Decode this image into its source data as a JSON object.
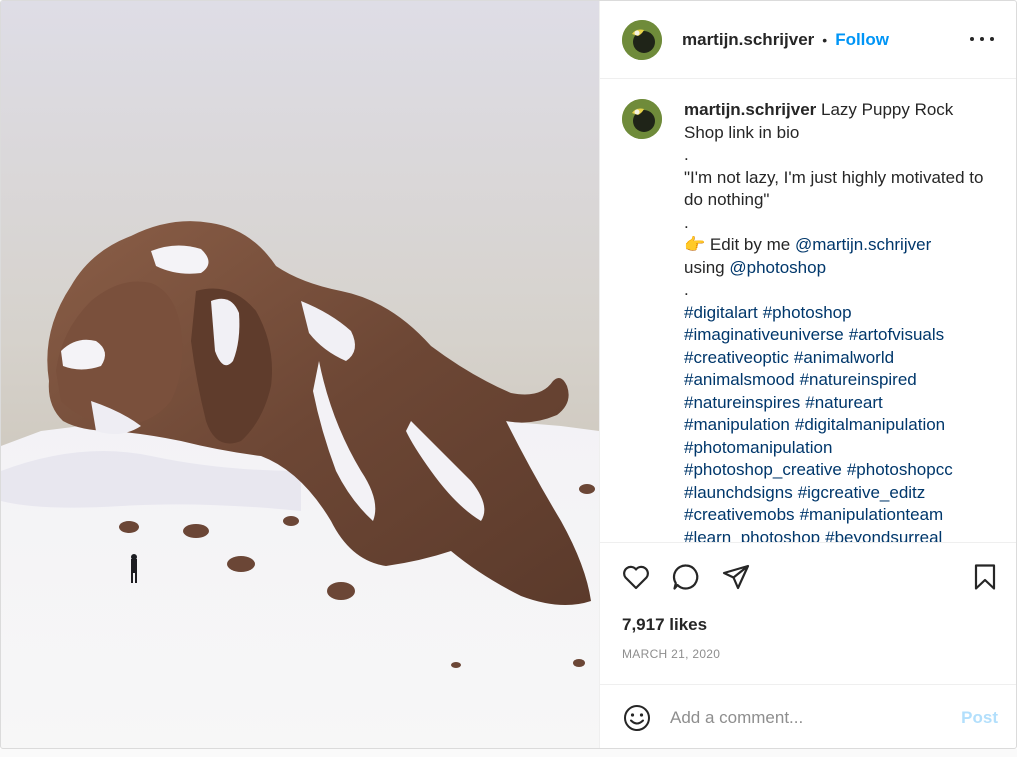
{
  "post": {
    "username": "martijn.schrijver",
    "separator": "•",
    "follow_label": "Follow"
  },
  "caption": {
    "username": "martijn.schrijver",
    "title": "Lazy Puppy Rock",
    "line_shop": "Shop link in bio",
    "dot1": ".",
    "quote": "\"I'm not lazy, I'm just highly motivated to do nothing\"",
    "dot2": ".",
    "edit_emoji": "👉",
    "edit_prefix": "Edit by me",
    "edit_mention": "@martijn.schrijver",
    "using_prefix": "using",
    "using_mention": "@photoshop",
    "dot3": ".",
    "hashtags": [
      "#digitalart",
      "#photoshop",
      "#imaginativeuniverse",
      "#artofvisuals",
      "#creativeoptic",
      "#animalworld",
      "#animalsmood",
      "#natureinspired",
      "#natureinspires",
      "#natureart",
      "#manipulation",
      "#digitalmanipulation",
      "#photomanipulation",
      "#photoshop_creative",
      "#photoshopcc",
      "#launchdsigns",
      "#igcreative_editz",
      "#creativemobs",
      "#manipulationteam",
      "#learn_photoshop",
      "#beyondsurreal"
    ]
  },
  "stats": {
    "likes": "7,917 likes",
    "date": "MARCH 21, 2020"
  },
  "comment": {
    "placeholder": "Add a comment...",
    "post_label": "Post"
  },
  "colors": {
    "link_blue": "#0095f6",
    "mention_blue": "#00376b",
    "post_disabled": "#b2dffc",
    "text": "#262626",
    "muted": "#8e8e8e"
  },
  "icons": {
    "more": "more-options-icon",
    "like": "heart-icon",
    "comment": "comment-bubble-icon",
    "share": "paper-plane-icon",
    "save": "bookmark-icon",
    "emoji": "smiley-icon"
  }
}
